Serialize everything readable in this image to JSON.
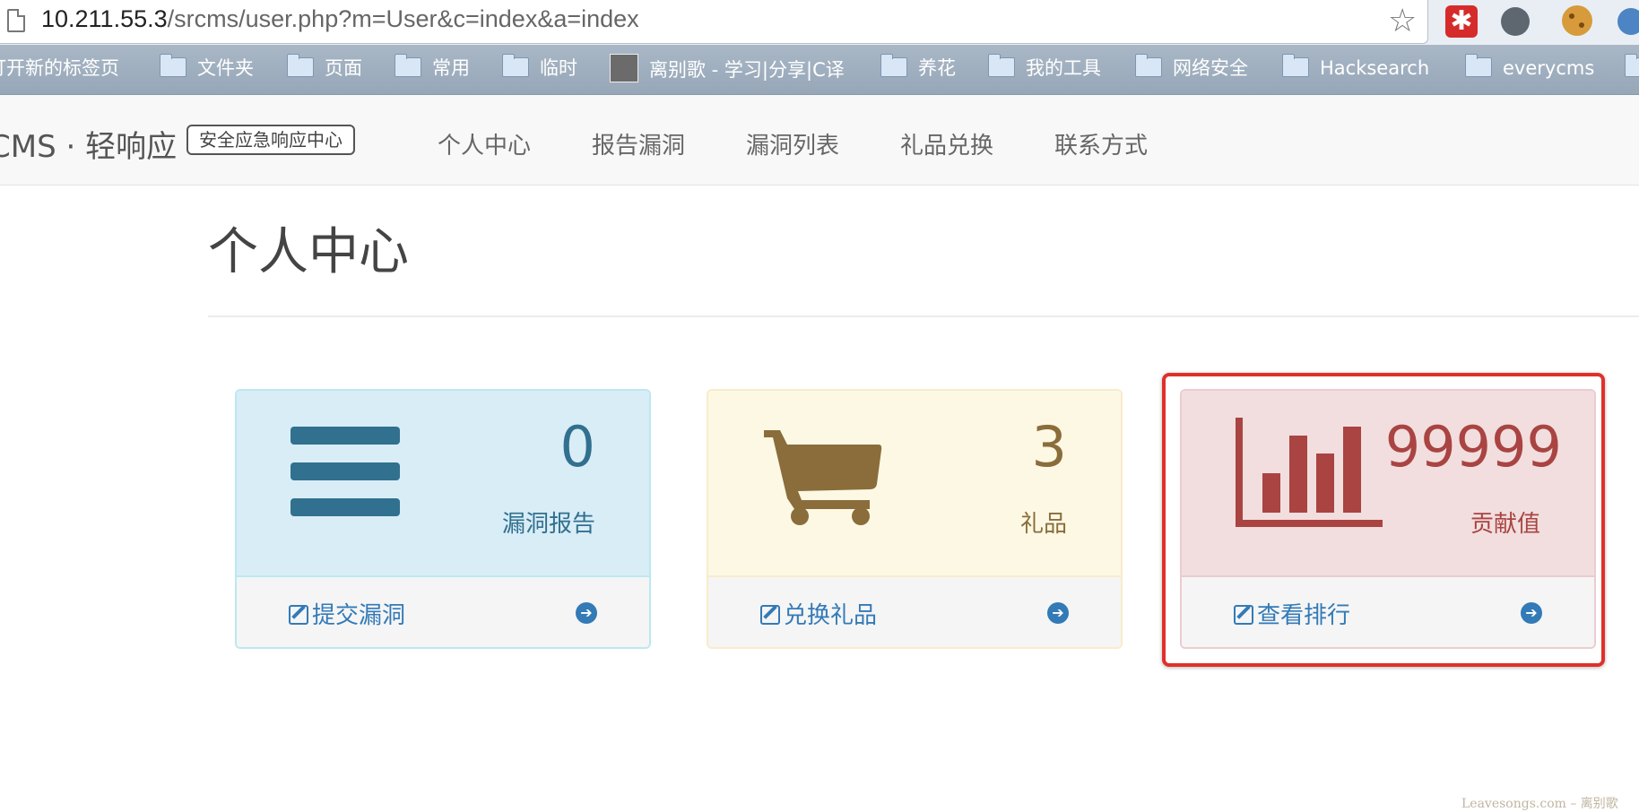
{
  "browser": {
    "url_host": "10.211.55.3",
    "url_path": "/srcms/user.php?m=User&c=index&a=index",
    "extensions": [
      "red-asterisk-icon",
      "hand-icon",
      "cookie-icon",
      "blue-gear-icon"
    ]
  },
  "bookmarks": [
    {
      "label": "打开新的标签页",
      "icon": "none"
    },
    {
      "label": "文件夹",
      "icon": "folder-icon"
    },
    {
      "label": "页面",
      "icon": "folder-icon"
    },
    {
      "label": "常用",
      "icon": "folder-icon"
    },
    {
      "label": "临时",
      "icon": "folder-icon"
    },
    {
      "label": "离别歌 - 学习|分享|C译",
      "icon": "site-favicon"
    },
    {
      "label": "养花",
      "icon": "folder-icon"
    },
    {
      "label": "我的工具",
      "icon": "folder-icon"
    },
    {
      "label": "网络安全",
      "icon": "folder-icon"
    },
    {
      "label": "Hacksearch",
      "icon": "folder-icon"
    },
    {
      "label": "everycms",
      "icon": "folder-icon"
    }
  ],
  "nav": {
    "brand": "CMS · 轻响应",
    "brand_tag": "安全应急响应中心",
    "items": [
      "个人中心",
      "报告漏洞",
      "漏洞列表",
      "礼品兑换",
      "联系方式"
    ]
  },
  "main": {
    "title": "个人中心",
    "panels": [
      {
        "value": "0",
        "label": "漏洞报告",
        "link": "提交漏洞",
        "icon": "list-icon",
        "color": "#31708f"
      },
      {
        "value": "3",
        "label": "礼品",
        "link": "兑换礼品",
        "icon": "shopping-cart-icon",
        "color": "#8a6d3b"
      },
      {
        "value": "99999",
        "label": "贡献值",
        "link": "查看排行",
        "icon": "bar-chart-icon",
        "color": "#a94442"
      }
    ]
  },
  "watermark": "Leavesongs.com – 离别歌"
}
